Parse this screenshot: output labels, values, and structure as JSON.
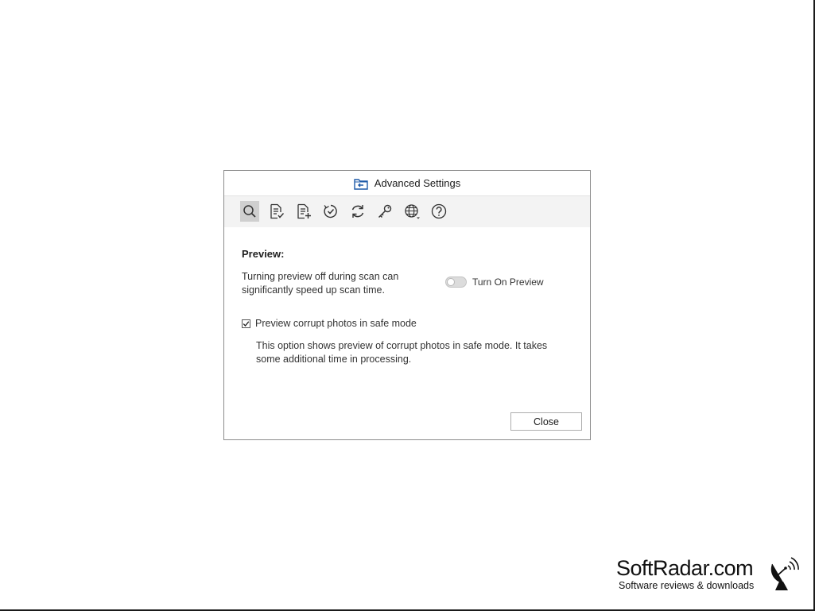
{
  "dialog": {
    "title": "Advanced Settings",
    "title_icon": "folder-back-icon"
  },
  "toolbar": {
    "items": [
      {
        "icon": "search-icon",
        "active": true
      },
      {
        "icon": "document-check-icon",
        "active": false
      },
      {
        "icon": "document-add-icon",
        "active": false
      },
      {
        "icon": "circle-check-icon",
        "active": false
      },
      {
        "icon": "refresh-icon",
        "active": false
      },
      {
        "icon": "key-icon",
        "active": false
      },
      {
        "icon": "globe-icon",
        "active": false
      },
      {
        "icon": "help-icon",
        "active": false
      }
    ]
  },
  "preview": {
    "heading": "Preview:",
    "description": "Turning preview off during scan can significantly speed up scan time.",
    "toggle_label": "Turn On Preview",
    "toggle_on": false
  },
  "safe_mode": {
    "label": "Preview corrupt photos in safe mode",
    "checked": true,
    "note": "This option shows preview of corrupt photos in safe mode. It takes some additional time in processing."
  },
  "buttons": {
    "close_label": "Close"
  },
  "watermark": {
    "name": "SoftRadar.com",
    "tagline": "Software reviews & downloads"
  },
  "colors": {
    "accent_icon": "#1e5aa8",
    "toolbar_bg": "#f3f3f3",
    "active_tool_bg": "#cfcfcf"
  }
}
